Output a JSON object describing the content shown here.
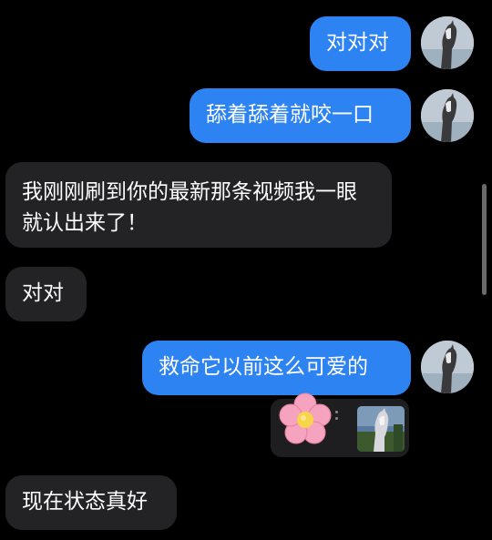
{
  "messages": [
    {
      "text": "对对对"
    },
    {
      "text": "舔着舔着就咬一口"
    },
    {
      "text": "我刚刚刷到你的最新那条视频我一眼就认出来了！"
    },
    {
      "text": "对对"
    },
    {
      "text": "救命它以前这么可爱的"
    },
    {
      "text": "现在状态真好"
    }
  ],
  "colors": {
    "background": "#000000",
    "outgoing_bubble": "#2d83f2",
    "incoming_bubble": "#232325",
    "text": "#ffffff"
  },
  "icons": {
    "avatar": "horse-avatar",
    "sticker": "pink-flower-sticker",
    "thumbnail": "horse-photo-thumbnail"
  }
}
